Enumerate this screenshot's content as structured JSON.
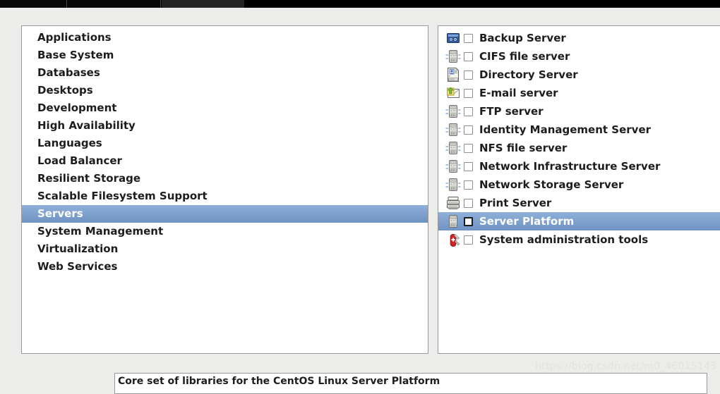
{
  "window": {
    "topbar_segments": [
      "",
      "",
      "",
      ""
    ]
  },
  "environments": {
    "panel_label": "environment-list",
    "selected": "Servers",
    "items": [
      {
        "label": "Applications",
        "selected": false
      },
      {
        "label": "Base System",
        "selected": false
      },
      {
        "label": "Databases",
        "selected": false
      },
      {
        "label": "Desktops",
        "selected": false
      },
      {
        "label": "Development",
        "selected": false
      },
      {
        "label": "High Availability",
        "selected": false
      },
      {
        "label": "Languages",
        "selected": false
      },
      {
        "label": "Load Balancer",
        "selected": false
      },
      {
        "label": "Resilient Storage",
        "selected": false
      },
      {
        "label": "Scalable Filesystem Support",
        "selected": false
      },
      {
        "label": "Servers",
        "selected": true
      },
      {
        "label": "System Management",
        "selected": false
      },
      {
        "label": "Virtualization",
        "selected": false
      },
      {
        "label": "Web Services",
        "selected": false
      }
    ]
  },
  "addons": {
    "panel_label": "addon-list",
    "selected": "Server Platform",
    "items": [
      {
        "label": "Backup Server",
        "icon": "tape-drive-icon",
        "checked": false,
        "selected": false
      },
      {
        "label": "CIFS file server",
        "icon": "server-tower-icon",
        "checked": false,
        "selected": false
      },
      {
        "label": "Directory Server",
        "icon": "address-card-icon",
        "checked": false,
        "selected": false
      },
      {
        "label": "E-mail server",
        "icon": "envelope-arrow-icon",
        "checked": false,
        "selected": false
      },
      {
        "label": "FTP server",
        "icon": "server-tower-icon",
        "checked": false,
        "selected": false
      },
      {
        "label": "Identity Management Server",
        "icon": "server-tower-icon",
        "checked": false,
        "selected": false
      },
      {
        "label": "NFS file server",
        "icon": "server-tower-icon",
        "checked": false,
        "selected": false
      },
      {
        "label": "Network Infrastructure Server",
        "icon": "server-tower-icon",
        "checked": false,
        "selected": false
      },
      {
        "label": "Network Storage Server",
        "icon": "server-tower-icon",
        "checked": false,
        "selected": false
      },
      {
        "label": "Print Server",
        "icon": "printer-icon",
        "checked": false,
        "selected": false
      },
      {
        "label": "Server Platform",
        "icon": "server-tower-icon",
        "checked": false,
        "selected": true
      },
      {
        "label": "System administration tools",
        "icon": "swiss-knife-icon",
        "checked": false,
        "selected": false
      }
    ]
  },
  "description": {
    "text": "Core set of libraries for the CentOS Linux Server Platform"
  },
  "watermark": {
    "text": "https://blog.csdn.net/m0_46015143"
  },
  "colors": {
    "selection_blue": "#7fa1cd",
    "panel_border": "#9a9a9a",
    "page_background": "#ececea",
    "text": "#1d1d1d"
  }
}
